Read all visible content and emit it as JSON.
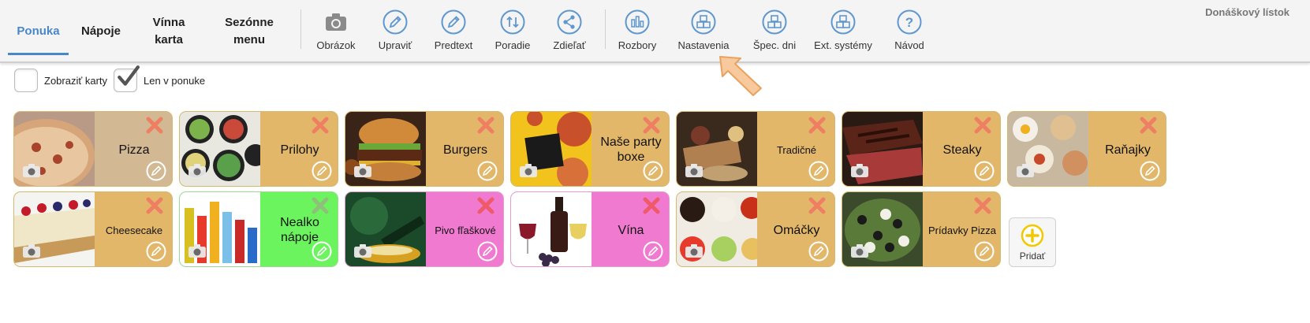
{
  "app_label": "Donáškový lístok",
  "nav_tabs": [
    {
      "label": "Ponuka",
      "active": true
    },
    {
      "label": "Nápoje",
      "active": false
    },
    {
      "label": "Vínna karta",
      "active": false
    },
    {
      "label": "Sezónne menu",
      "active": false
    }
  ],
  "toolbar": {
    "group1": [
      {
        "label": "Obrázok",
        "icon": "camera-icon"
      },
      {
        "label": "Upraviť",
        "icon": "pencil-icon"
      },
      {
        "label": "Predtext",
        "icon": "pencil-icon"
      },
      {
        "label": "Poradie",
        "icon": "sort-arrows-icon"
      },
      {
        "label": "Zdieľať",
        "icon": "share-icon"
      }
    ],
    "group2": [
      {
        "label": "Rozbory",
        "icon": "bar-chart-icon"
      },
      {
        "label": "Nastavenia",
        "icon": "boxes-icon"
      },
      {
        "label": "Špec. dni",
        "icon": "boxes-icon"
      },
      {
        "label": "Ext. systémy",
        "icon": "boxes-icon"
      },
      {
        "label": "Návod",
        "icon": "question-icon"
      }
    ]
  },
  "filters": [
    {
      "label": "Zobraziť karty",
      "checked": false
    },
    {
      "label": "Len v ponuke",
      "checked": true
    }
  ],
  "colors": {
    "accent": "#4a87c9",
    "card_tan": "#e2b76a",
    "card_beige": "#d2b993",
    "card_green": "#6cf45e",
    "card_pink": "#f07ad0",
    "delete": "#ef7f62"
  },
  "categories": [
    {
      "name": "Pizza",
      "color": "#d2b993"
    },
    {
      "name": "Prilohy",
      "color": "#e2b76a"
    },
    {
      "name": "Burgers",
      "color": "#e2b76a"
    },
    {
      "name": "Naše party boxe",
      "color": "#e2b76a"
    },
    {
      "name": "Tradičné",
      "color": "#e2b76a"
    },
    {
      "name": "Steaky",
      "color": "#e2b76a"
    },
    {
      "name": "Raňajky",
      "color": "#e2b76a"
    },
    {
      "name": "Cheesecake",
      "color": "#e2b76a"
    },
    {
      "name": "Nealko nápoje",
      "color": "#6cf45e"
    },
    {
      "name": "Pivo fľaškové",
      "color": "#f07ad0"
    },
    {
      "name": "Vína",
      "color": "#f07ad0"
    },
    {
      "name": "Omáčky",
      "color": "#e2b76a"
    },
    {
      "name": "Prídavky Pizza",
      "color": "#e2b76a"
    }
  ],
  "add_button": {
    "label": "Pridať"
  }
}
